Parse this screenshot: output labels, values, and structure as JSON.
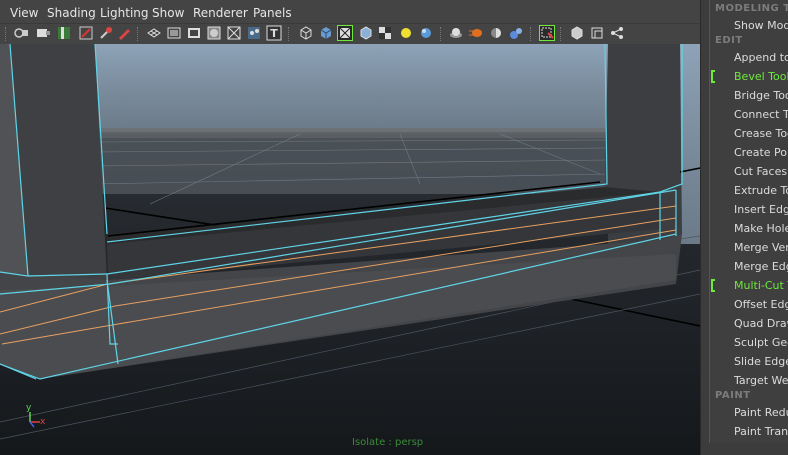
{
  "menu": [
    "View",
    "Shading",
    "Lighting",
    "Show",
    "Renderer",
    "Panels"
  ],
  "viewport": {
    "hud_label": "Isolate : persp",
    "axis_y": "y",
    "axis_x": "x"
  },
  "tool_panel": {
    "title": "MODELING TO",
    "items": [
      {
        "type": "item",
        "label": "Show Mode"
      },
      {
        "type": "header",
        "label": "EDIT"
      },
      {
        "type": "item",
        "label": "Append to P"
      },
      {
        "type": "item",
        "label": "Bevel Tool",
        "active": true
      },
      {
        "type": "item",
        "label": "Bridge Tool"
      },
      {
        "type": "item",
        "label": "Connect To"
      },
      {
        "type": "item",
        "label": "Crease Too"
      },
      {
        "type": "item",
        "label": "Create Poly"
      },
      {
        "type": "item",
        "label": "Cut Faces T"
      },
      {
        "type": "item",
        "label": "Extrude Too"
      },
      {
        "type": "item",
        "label": "Insert Edge"
      },
      {
        "type": "item",
        "label": "Make Hole T"
      },
      {
        "type": "item",
        "label": "Merge Verte"
      },
      {
        "type": "item",
        "label": "Merge Edge"
      },
      {
        "type": "item",
        "label": "Multi-Cut To",
        "active": true
      },
      {
        "type": "item",
        "label": "Offset Edge"
      },
      {
        "type": "item",
        "label": "Quad Draw"
      },
      {
        "type": "item",
        "label": "Sculpt Geom"
      },
      {
        "type": "item",
        "label": "Slide Edge T"
      },
      {
        "type": "item",
        "label": "Target Weld"
      },
      {
        "type": "header",
        "label": "PAINT"
      },
      {
        "type": "item",
        "label": "Paint Reduc"
      },
      {
        "type": "item",
        "label": "Paint Transf"
      }
    ]
  },
  "colors": {
    "selection_cyan": "#5fd4e6",
    "edge_orange": "#e8a060",
    "active_green": "#6eea3a"
  }
}
